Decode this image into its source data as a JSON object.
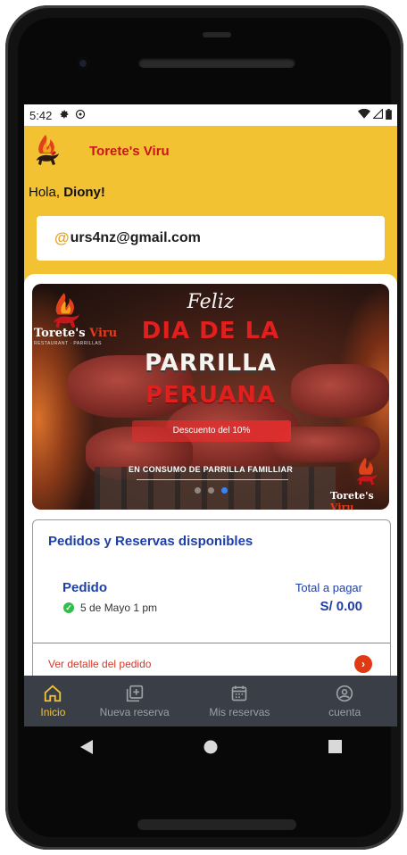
{
  "status_bar": {
    "time": "5:42",
    "left_icons": [
      "gear-icon",
      "sync-icon"
    ],
    "right_icons": [
      "wifi-icon",
      "signal-icon",
      "battery-icon"
    ]
  },
  "header": {
    "brand": "Torete's Viru",
    "greeting_prefix": "Hola, ",
    "user_name": "Diony!",
    "email_symbol": "@",
    "email": "urs4nz@gmail.com",
    "background": "#f2c232"
  },
  "banner": {
    "logo_text_main": "Torete's",
    "logo_text_accent": "Viru",
    "logo_subtext": "RESTAURANT · PARRILLAS",
    "line_feliz": "Feliz",
    "line_1": "DIA DE LA",
    "line_2": "PARRILLA",
    "line_3": "PERUANA",
    "discount": "Descuento del 10%",
    "consumo": "EN CONSUMO DE PARRILLA FAMILLIAR",
    "corner_logo_main": "Torete's",
    "corner_logo_accent": "Viru",
    "carousel_total": 3,
    "carousel_active": 3
  },
  "orders": {
    "title": "Pedidos y Reservas disponibles",
    "order_label": "Pedido",
    "total_label": "Total a pagar",
    "date": "5 de Mayo 1 pm",
    "total": "S/ 0.00",
    "detail_link": "Ver detalle del pedido"
  },
  "bottom_nav": {
    "items": [
      {
        "label": "Inicio",
        "icon": "home-icon",
        "active": true
      },
      {
        "label": "Nueva reserva",
        "icon": "add-box-icon",
        "active": false
      },
      {
        "label": "Mis reservas",
        "icon": "calendar-icon",
        "active": false
      },
      {
        "label": "cuenta",
        "icon": "account-icon",
        "active": false
      }
    ]
  },
  "colors": {
    "brand_red": "#c8161d",
    "primary_blue": "#1f3fa8",
    "nav_active": "#f2c232",
    "nav_background": "#3a3f47"
  }
}
